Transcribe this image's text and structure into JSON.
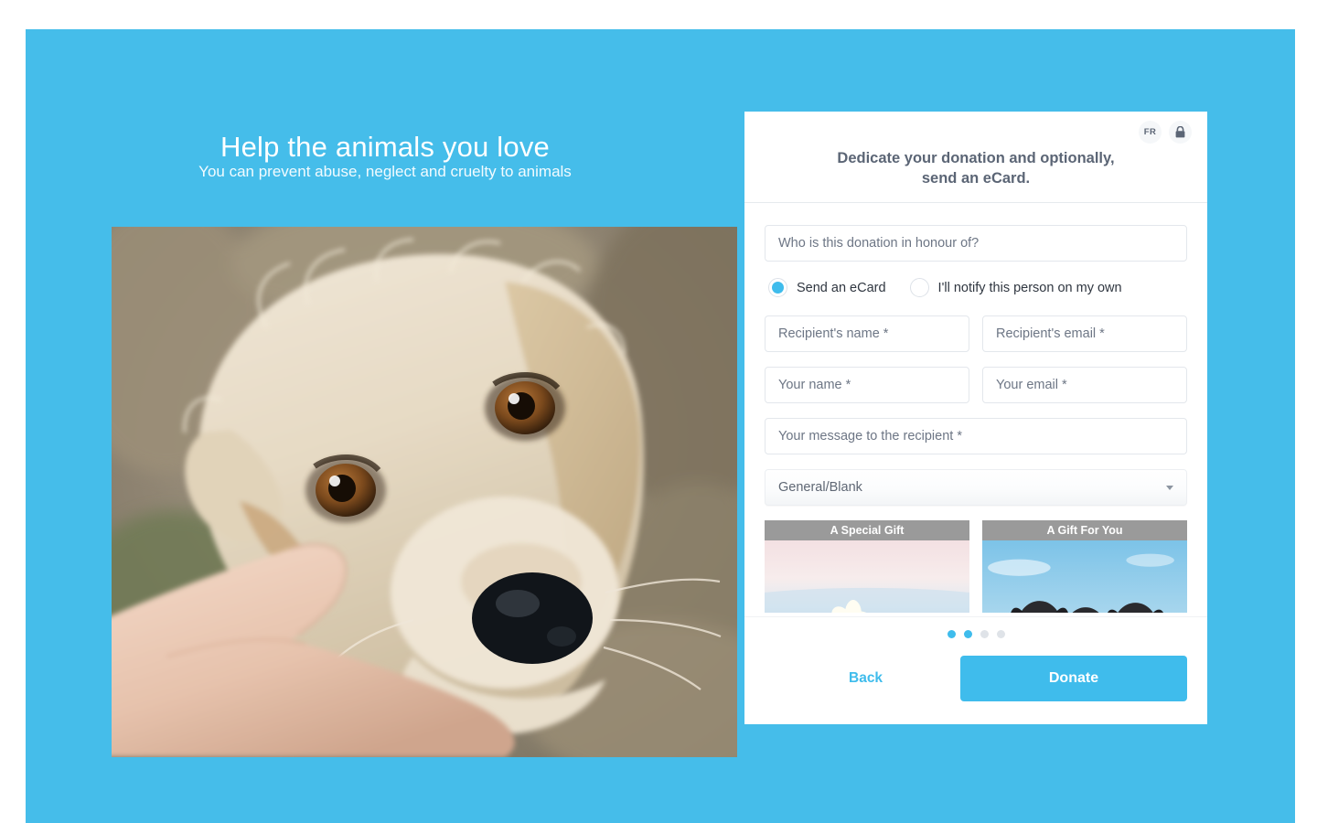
{
  "page": {
    "background_color": "#ffffff",
    "brand_blue": "#45bdea",
    "accent_blue": "#3fbcec"
  },
  "hero": {
    "title": "Help the animals you love",
    "subtitle": "You can prevent abuse, neglect and cruelty to animals",
    "photo_alt": "Close-up of a scruffy cream and tan terrier dog being petted under the chin by a hand"
  },
  "card": {
    "header": {
      "title": "Dedicate your donation and optionally,\nsend an eCard.",
      "language_button": "FR",
      "lock_icon": "lock-icon"
    },
    "fields": {
      "honouree_placeholder": "Who is this donation in honour of?",
      "recipient_name_placeholder": "Recipient's name *",
      "recipient_email_placeholder": "Recipient's email *",
      "your_name_placeholder": "Your name *",
      "your_email_placeholder": "Your email *",
      "message_placeholder": "Your message to the recipient *",
      "honouree_value": "",
      "recipient_name_value": "",
      "recipient_email_value": "",
      "your_name_value": "",
      "your_email_value": "",
      "message_value": ""
    },
    "notification_options": [
      {
        "label": "Send an eCard",
        "selected": true
      },
      {
        "label": "I'll notify this person on my own",
        "selected": false
      }
    ],
    "category_select": {
      "selected": "General/Blank",
      "caret_icon": "chevron-down-icon"
    },
    "ecards": [
      {
        "caption": "A Special Gift",
        "art": "frangipani-flower-on-beach"
      },
      {
        "caption": "A Gift For You",
        "art": "three-puppies-under-blue-sky"
      }
    ],
    "pagination": {
      "dots": [
        {
          "active": true
        },
        {
          "active": true
        },
        {
          "active": false
        },
        {
          "active": false
        }
      ]
    },
    "footer": {
      "back_label": "Back",
      "donate_label": "Donate"
    }
  }
}
